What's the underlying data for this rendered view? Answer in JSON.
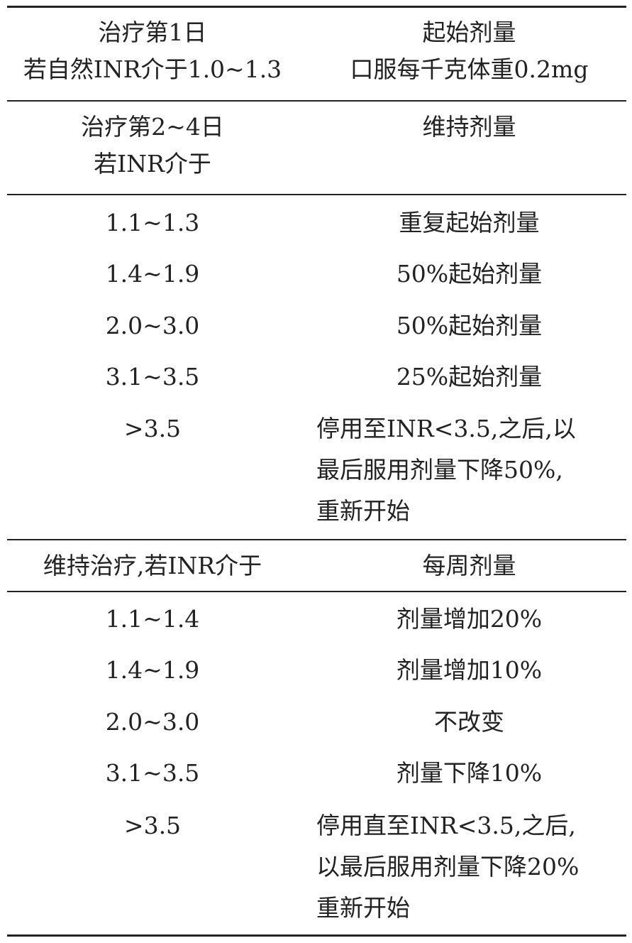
{
  "header": {
    "left": [
      "治疗第1日",
      "若自然INR介于1.0~1.3"
    ],
    "right": [
      "起始剂量",
      "口服每千克体重0.2mg"
    ]
  },
  "phase2_header": {
    "left": [
      "治疗第2~4日",
      "若INR介于"
    ],
    "right": [
      "维持剂量"
    ]
  },
  "phase2_rows": [
    {
      "inr": "1.1~1.3",
      "dose": [
        "重复起始剂量"
      ]
    },
    {
      "inr": "1.4~1.9",
      "dose": [
        "50%起始剂量"
      ]
    },
    {
      "inr": "2.0~3.0",
      "dose": [
        "50%起始剂量"
      ]
    },
    {
      "inr": "3.1~3.5",
      "dose": [
        "25%起始剂量"
      ]
    },
    {
      "inr": ">3.5",
      "dose": [
        "停用至INR<3.5,之后,以",
        "最后服用剂量下降50%,",
        "重新开始"
      ]
    }
  ],
  "maintenance_header": {
    "left": "维持治疗,若INR介于",
    "right": "每周剂量"
  },
  "maintenance_rows": [
    {
      "inr": "1.1~1.4",
      "dose": [
        "剂量增加20%"
      ]
    },
    {
      "inr": "1.4~1.9",
      "dose": [
        "剂量增加10%"
      ]
    },
    {
      "inr": "2.0~3.0",
      "dose": [
        "不改变"
      ]
    },
    {
      "inr": "3.1~3.5",
      "dose": [
        "剂量下降10%"
      ]
    },
    {
      "inr": ">3.5",
      "dose": [
        "停用直至INR<3.5,之后,",
        "以最后服用剂量下降20%",
        "重新开始"
      ]
    }
  ]
}
